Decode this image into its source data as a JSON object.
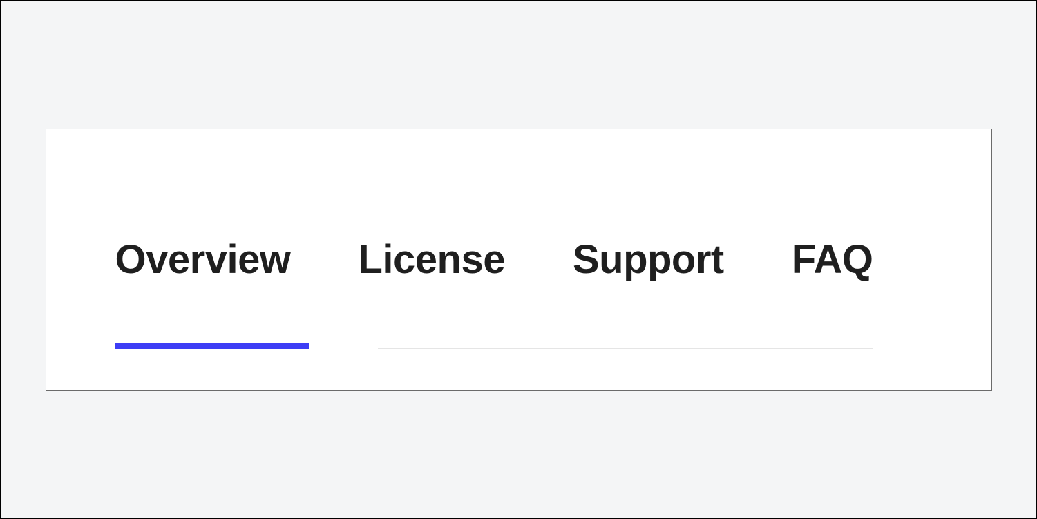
{
  "tabs": [
    {
      "label": "Overview",
      "active": true
    },
    {
      "label": "License",
      "active": false
    },
    {
      "label": "Support",
      "active": false
    },
    {
      "label": "FAQ",
      "active": false
    }
  ],
  "colors": {
    "accent": "#3d3df5",
    "text": "#1f1f1f",
    "panel_border": "#6b6b6b",
    "page_bg": "#f4f5f6",
    "divider": "#e5e5e5"
  }
}
